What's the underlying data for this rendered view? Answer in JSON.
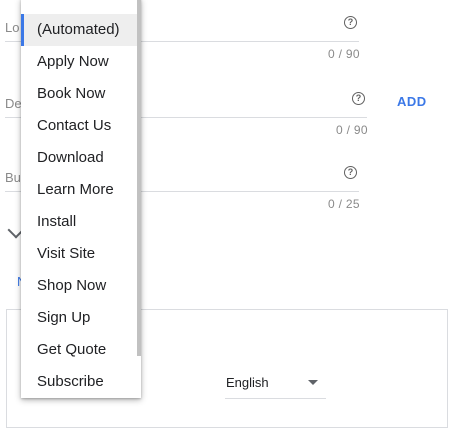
{
  "fields": [
    {
      "label": "Lo",
      "counter": "0 / 90"
    },
    {
      "label": "De",
      "counter": "0 / 90"
    },
    {
      "label": "Bu",
      "counter": "0 / 25"
    }
  ],
  "add_label": "ADD",
  "more_label": "N",
  "language": {
    "selected": "English"
  },
  "dropdown": {
    "items": [
      "(Automated)",
      "Apply Now",
      "Book Now",
      "Contact Us",
      "Download",
      "Learn More",
      "Install",
      "Visit Site",
      "Shop Now",
      "Sign Up",
      "Get Quote",
      "Subscribe"
    ],
    "selected_index": 0
  },
  "icons": {
    "help": "help-circle-icon",
    "chevron": "chevron-down-icon",
    "caret": "dropdown-caret-icon"
  },
  "colors": {
    "accent": "#3b78e7",
    "selected_bg": "#eeeeee"
  }
}
